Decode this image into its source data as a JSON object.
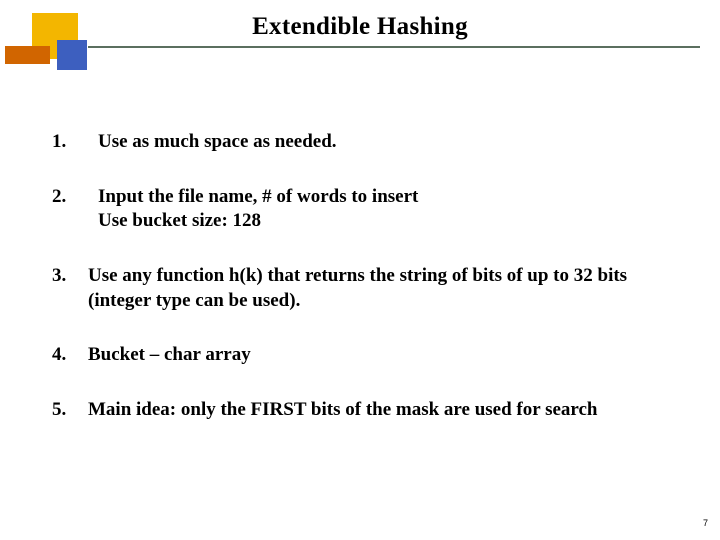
{
  "title": "Extendible Hashing",
  "items": {
    "n1": {
      "num": "1.",
      "text": "Use  as much space as needed."
    },
    "n2": {
      "num": "2.",
      "line1": "Input the file name, # of words to insert",
      "line2": "Use bucket size: 128"
    },
    "n3": {
      "num": "3.",
      "text": "Use any function h(k) that returns the string of bits of up to 32 bits (integer type can be used)."
    },
    "n4": {
      "num": "4.",
      "text": "Bucket – char array"
    },
    "n5": {
      "num": "5.",
      "text": "Main idea: only the FIRST bits of the mask are used for search"
    }
  },
  "page_number": "7"
}
